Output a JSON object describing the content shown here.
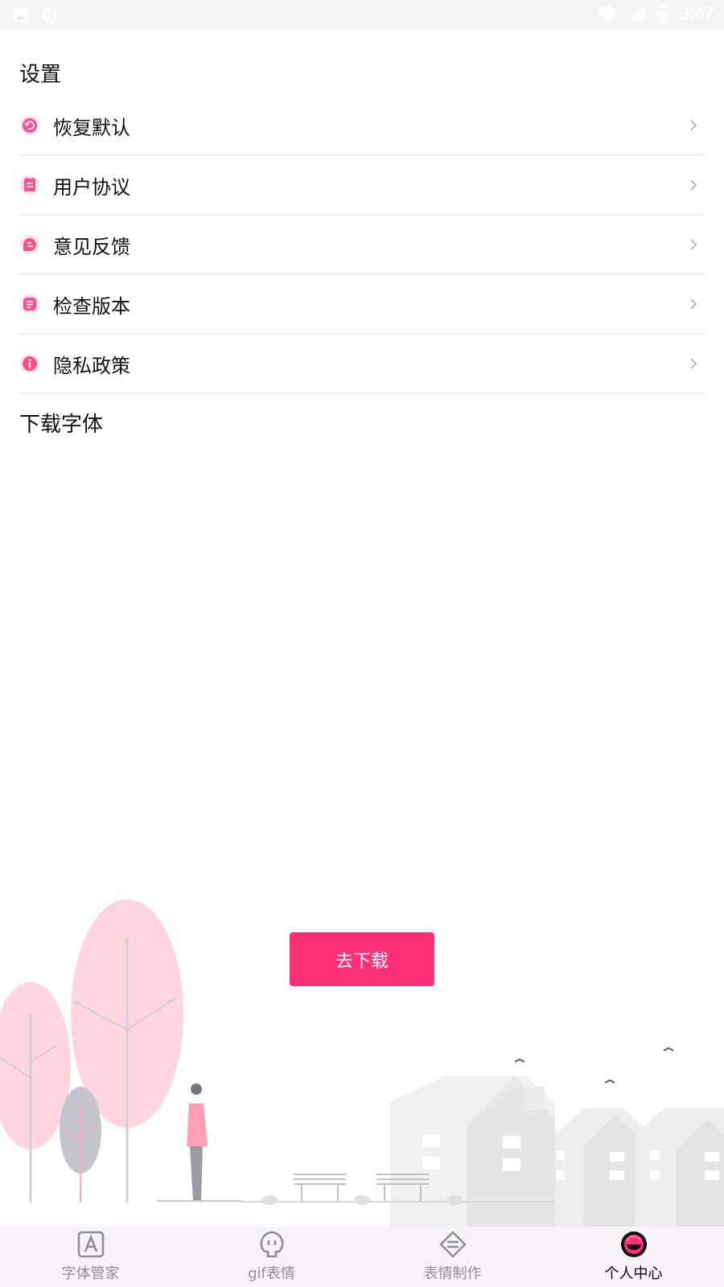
{
  "status_bar": {
    "time": "3:47",
    "left_icons": [
      "gallery-icon",
      "bug-icon"
    ],
    "right_icons": [
      "wifi-icon",
      "signal-icon",
      "battery-icon"
    ]
  },
  "settings": {
    "title": "设置",
    "items": [
      {
        "label": "恢复默认",
        "icon": "restore-icon"
      },
      {
        "label": "用户协议",
        "icon": "agreement-icon"
      },
      {
        "label": "意见反馈",
        "icon": "feedback-icon"
      },
      {
        "label": "检查版本",
        "icon": "version-icon"
      },
      {
        "label": "隐私政策",
        "icon": "privacy-icon"
      }
    ]
  },
  "fonts": {
    "title": "下载字体",
    "download_label": "去下载"
  },
  "bottom_nav": {
    "items": [
      {
        "label": "字体管家",
        "icon": "font-manager-icon",
        "active": false
      },
      {
        "label": "gif表情",
        "icon": "gif-icon",
        "active": false
      },
      {
        "label": "表情制作",
        "icon": "sticker-maker-icon",
        "active": false
      },
      {
        "label": "个人中心",
        "icon": "profile-icon",
        "active": true
      }
    ]
  },
  "colors": {
    "accent": "#ff2f77",
    "icon_pink": "#ff4f8b",
    "divider": "#eeeeee",
    "nav_bg": "#f6f2f7",
    "tree_pink": "#ffd6dd"
  }
}
